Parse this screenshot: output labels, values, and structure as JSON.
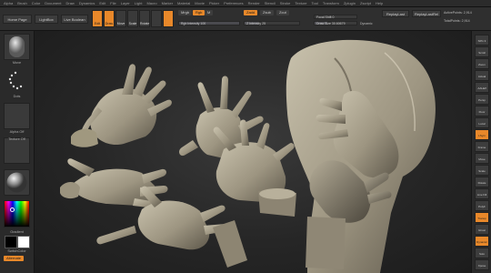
{
  "menu": [
    "Alpha",
    "Brush",
    "Color",
    "Document",
    "Draw",
    "Dynamics",
    "Edit",
    "File",
    "Layer",
    "Light",
    "Macro",
    "Marker",
    "Material",
    "Movie",
    "Picker",
    "Preferences",
    "Render",
    "Stencil",
    "Stroke",
    "Texture",
    "Tool",
    "Transform",
    "Zplugin",
    "Zscript",
    "Help"
  ],
  "toolbar": {
    "home_page": "Home Page",
    "lightbox": "LightBox",
    "live_boolean": "Live Boolean",
    "edit": "Edit",
    "draw": "Draw",
    "move": "Move",
    "scale": "Scale",
    "rotate": "Rotate",
    "mrgb": "Mrgb",
    "rgb": "Rgb",
    "m": "M",
    "zadd": "Zadd",
    "zsub": "Zsub",
    "zcut": "Zcut",
    "rgb_intensity": "Rgb Intensity 100",
    "z_intensity": "Z Intensity 25",
    "focal_shift": "Focal Shift 0",
    "draw_size": "Draw Size 30.60679",
    "dynamic": "Dynamic",
    "replay_last": "ReplayLast",
    "replay_last_rel": "ReplayLastRel",
    "active_points": "ActivePoints: 2,914",
    "total_points": "TotalPoints: 2,914"
  },
  "left_panel": {
    "brush_label": "Move",
    "stroke_label": "Dots",
    "alpha_label": "Alpha Off",
    "texture_label": "Texture Off",
    "material_label": "",
    "gradient": "Gradient",
    "switch_color": "SwitchColor",
    "alternate": "Alternate"
  },
  "right_panel": [
    "SPix 3",
    "Scroll",
    "Zoom",
    "Actual",
    "AAHalf",
    "Persp",
    "Floor",
    "Local",
    "LSym",
    "Frame",
    "Move",
    "Scale",
    "Rotate",
    "Line Fill",
    "PolyF",
    "Transp",
    "Ghost",
    "Dynamic",
    "Solo",
    "Xpose"
  ],
  "colors": {
    "accent": "#e8882a",
    "viewport": "#2a2a2a",
    "clay": "#a29a87"
  }
}
